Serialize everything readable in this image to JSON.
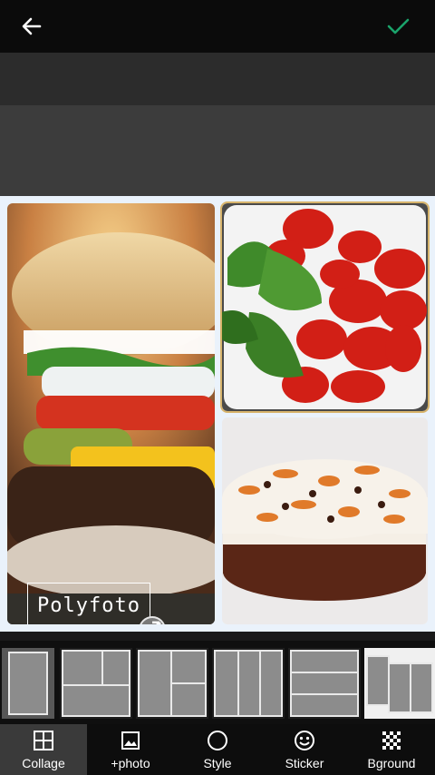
{
  "toolbar": {
    "back_icon": "arrow-left-icon",
    "confirm_icon": "check-icon",
    "confirm_color": "#1aa36b"
  },
  "watermark": {
    "text": "Polyfoto"
  },
  "tabs": [
    {
      "label": "Collage",
      "icon": "grid-icon",
      "active": true
    },
    {
      "label": "+photo",
      "icon": "image-icon",
      "active": false
    },
    {
      "label": "Style",
      "icon": "circle-icon",
      "active": false
    },
    {
      "label": "Sticker",
      "icon": "smiley-icon",
      "active": false
    },
    {
      "label": "Bground",
      "icon": "pattern-icon",
      "active": false
    }
  ],
  "layouts": [
    "single",
    "grid-three",
    "grid-two-wide",
    "three-columns",
    "three-rows",
    "offset-columns"
  ],
  "photos": [
    "burger",
    "tomatoes-basil",
    "cake"
  ]
}
